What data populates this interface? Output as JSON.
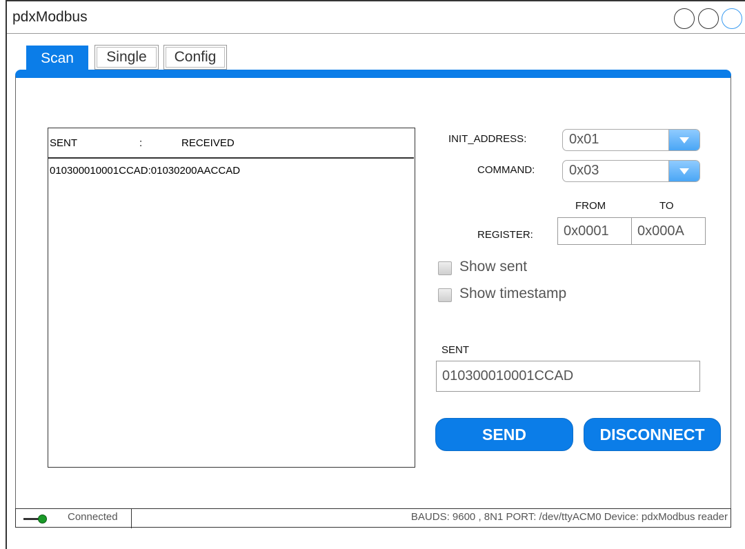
{
  "app": {
    "title": "pdxModbus"
  },
  "tabs": [
    {
      "label": "Scan",
      "active": true
    },
    {
      "label": "Single",
      "active": false
    },
    {
      "label": "Config",
      "active": false
    }
  ],
  "log": {
    "header_sent": "SENT",
    "header_sep": ":",
    "header_received": "RECEIVED",
    "lines": [
      "010300010001CCAD:01030200AACCAD"
    ]
  },
  "form": {
    "init_address": {
      "label": "INIT_ADDRESS:",
      "value": "0x01"
    },
    "command": {
      "label": "COMMAND:",
      "value": "0x03"
    },
    "register": {
      "label": "REGISTER:",
      "from_label": "FROM",
      "to_label": "TO",
      "from_value": "0x0001",
      "to_value": "0x000A"
    },
    "show_sent": {
      "label": "Show sent",
      "checked": false
    },
    "show_timestamp": {
      "label": "Show timestamp",
      "checked": false
    },
    "sent": {
      "label": "SENT",
      "value": "010300010001CCAD"
    }
  },
  "buttons": {
    "send": "SEND",
    "disconnect": "DISCONNECT"
  },
  "status": {
    "connection": "Connected",
    "info": "BAUDS: 9600 , 8N1 PORT: /dev/ttyACM0 Device: pdxModbus reader"
  },
  "colors": {
    "accent": "#0b7de8",
    "connected": "#1a9a28"
  }
}
